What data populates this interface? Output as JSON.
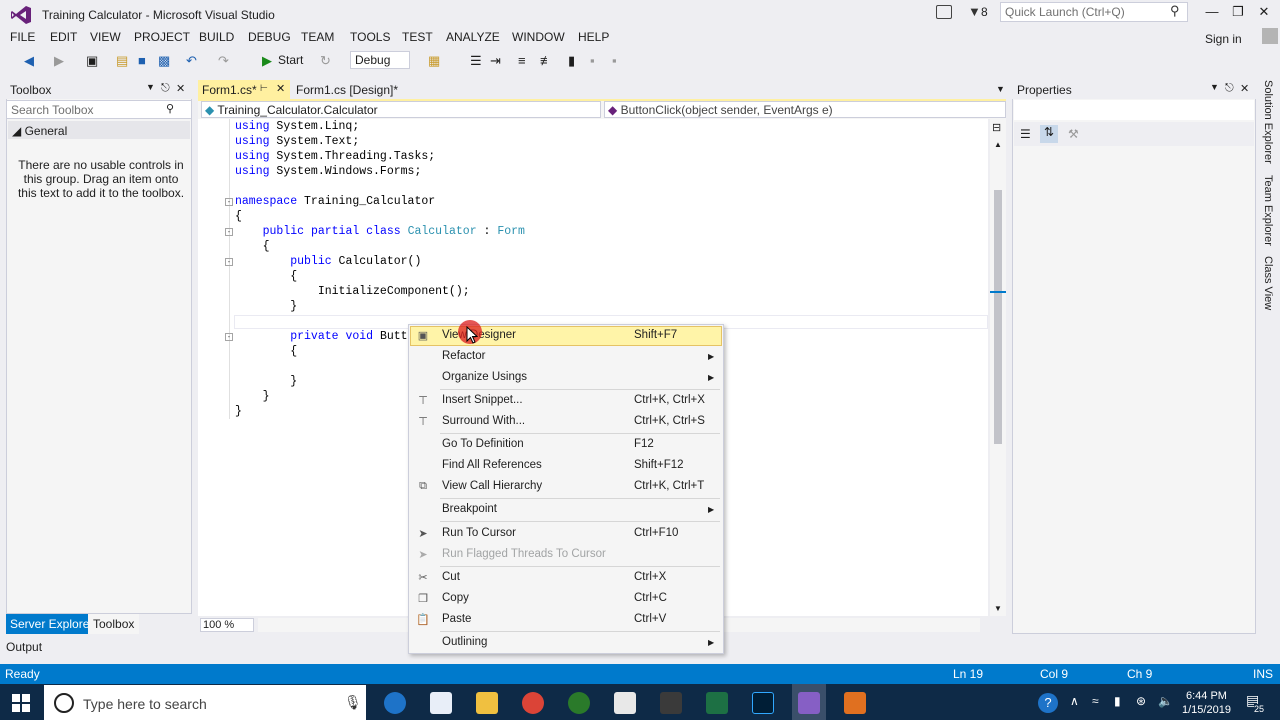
{
  "window": {
    "title": "Training Calculator - Microsoft Visual Studio"
  },
  "titlebar": {
    "filter_count": "8",
    "quick_launch_placeholder": "Quick Launch (Ctrl+Q)",
    "signin": "Sign in"
  },
  "menu": [
    "FILE",
    "EDIT",
    "VIEW",
    "PROJECT",
    "BUILD",
    "DEBUG",
    "TEAM",
    "TOOLS",
    "TEST",
    "ANALYZE",
    "WINDOW",
    "HELP"
  ],
  "toolbar": {
    "start_label": "Start",
    "config": "Debug"
  },
  "toolbox": {
    "title": "Toolbox",
    "search_placeholder": "Search Toolbox",
    "group": "General",
    "empty_text": "There are no usable controls in this group. Drag an item onto this text to add it to the toolbox.",
    "tabs": [
      "Server Explorer",
      "Toolbox"
    ]
  },
  "editor": {
    "tabs": [
      {
        "label": "Form1.cs*",
        "active": true
      },
      {
        "label": "Form1.cs [Design]*",
        "active": false
      }
    ],
    "nav_left": "Training_Calculator.Calculator",
    "nav_right": "ButtonClick(object sender, EventArgs e)",
    "zoom": "100 %",
    "lines": [
      "using System.Linq;",
      "using System.Text;",
      "using System.Threading.Tasks;",
      "using System.Windows.Forms;",
      "",
      "namespace Training_Calculator",
      "{",
      "    public partial class Calculator : Form",
      "    {",
      "        public Calculator()",
      "        {",
      "            InitializeComponent();",
      "        }",
      "",
      "        private void Butto",
      "        {",
      "",
      "        }",
      "    }",
      "}"
    ]
  },
  "properties": {
    "title": "Properties"
  },
  "side_tabs": [
    "Solution Explorer",
    "Team Explorer",
    "Class View"
  ],
  "output": {
    "label": "Output"
  },
  "status": {
    "ready": "Ready",
    "ln": "Ln 19",
    "col": "Col 9",
    "ch": "Ch 9",
    "ins": "INS"
  },
  "taskbar": {
    "search_placeholder": "Type here to search",
    "time": "6:44 PM",
    "date": "1/15/2019",
    "notif_count": "25"
  },
  "context_menu": [
    {
      "label": "View Designer",
      "shortcut": "Shift+F7",
      "icon": "view-designer-icon",
      "highlighted": true
    },
    {
      "label": "Refactor",
      "submenu": true
    },
    {
      "label": "Organize Usings",
      "submenu": true
    },
    {
      "sep": true
    },
    {
      "label": "Insert Snippet...",
      "shortcut": "Ctrl+K, Ctrl+X",
      "icon": "snippet-icon"
    },
    {
      "label": "Surround With...",
      "shortcut": "Ctrl+K, Ctrl+S",
      "icon": "surround-icon"
    },
    {
      "sep": true
    },
    {
      "label": "Go To Definition",
      "shortcut": "F12"
    },
    {
      "label": "Find All References",
      "shortcut": "Shift+F12"
    },
    {
      "label": "View Call Hierarchy",
      "shortcut": "Ctrl+K, Ctrl+T",
      "icon": "call-hierarchy-icon"
    },
    {
      "sep": true
    },
    {
      "label": "Breakpoint",
      "submenu": true
    },
    {
      "sep": true
    },
    {
      "label": "Run To Cursor",
      "shortcut": "Ctrl+F10",
      "icon": "run-cursor-icon"
    },
    {
      "label": "Run Flagged Threads To Cursor",
      "disabled": true,
      "icon": "run-flagged-icon"
    },
    {
      "sep": true
    },
    {
      "label": "Cut",
      "shortcut": "Ctrl+X",
      "icon": "scissors-icon"
    },
    {
      "label": "Copy",
      "shortcut": "Ctrl+C",
      "icon": "copy-icon"
    },
    {
      "label": "Paste",
      "shortcut": "Ctrl+V",
      "icon": "paste-icon"
    },
    {
      "sep": true
    },
    {
      "label": "Outlining",
      "submenu": true
    }
  ],
  "colors": {
    "accent": "#007acc",
    "tab_active": "#fff0a0",
    "keyword": "#0000ff",
    "type": "#2b91af",
    "taskbar": "#0e2a47"
  }
}
